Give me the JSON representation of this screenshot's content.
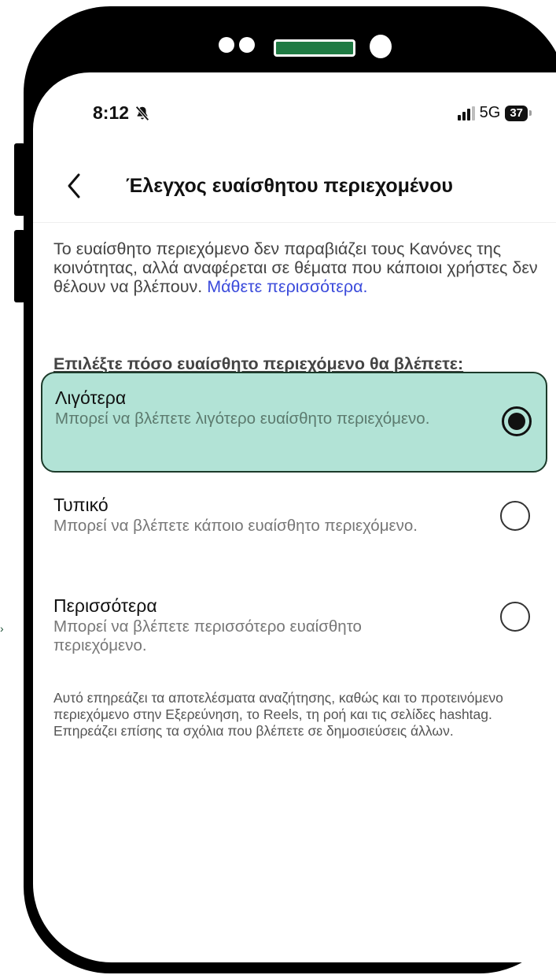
{
  "status_bar": {
    "time": "8:12",
    "network": "5G",
    "battery": "37"
  },
  "header": {
    "title": "Έλεγχος ευαίσθητου περιεχομένου"
  },
  "intro": {
    "text": "Το ευαίσθητο περιεχόμενο δεν παραβιάζει τους Κανόνες της κοινότητας, αλλά αναφέρεται σε θέματα που κάποιοι χρήστες δεν θέλουν να βλέπουν.",
    "learn_more": "Μάθετε περισσότερα."
  },
  "prompt": "Επιλέξτε πόσο ευαίσθητο περιεχόμενο θα βλέπετε:",
  "options": [
    {
      "title": "Λιγότερα",
      "description": "Μπορεί να βλέπετε λιγότερο ευαίσθητο περιεχόμενο.",
      "selected": true
    },
    {
      "title": "Τυπικό",
      "description": "Μπορεί να βλέπετε κάποιο ευαίσθητο περιεχόμενο.",
      "selected": false
    },
    {
      "title": "Περισσότερα",
      "description": "Μπορεί να βλέπετε περισσότερο ευαίσθητο περιεχόμενο.",
      "selected": false
    }
  ],
  "footer_note": "Αυτό επηρεάζει τα αποτελέσματα αναζήτησης, καθώς και το προτεινόμενο περιεχόμενο στην Εξερεύνηση, το Reels, τη ροή και τις σελίδες hashtag. Επηρεάζει επίσης τα σχόλια που βλέπετε σε δημοσιεύσεις άλλων.",
  "colors": {
    "selected_background": "#b2e3d6",
    "selected_border": "#1c3a2a",
    "link": "#3b4bdb",
    "phone_frame": "#000000",
    "speaker_accent": "#1f7a43"
  },
  "icons": {
    "back": "chevron-left-icon",
    "notifications": "bell-slash-icon",
    "signal": "signal-bars-icon",
    "battery": "battery-icon"
  }
}
